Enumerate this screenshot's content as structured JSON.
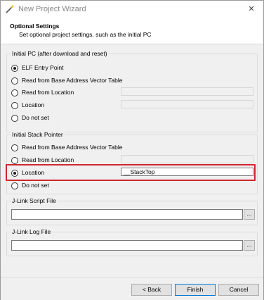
{
  "window": {
    "title": "New Project Wizard",
    "close_glyph": "✕",
    "icon": "wand-icon"
  },
  "header": {
    "title": "Optional Settings",
    "subtitle": "Set optional project settings, such as the initial PC"
  },
  "initial_pc": {
    "label": "Initial PC (after download and reset)",
    "options": [
      {
        "label": "ELF Entry Point",
        "checked": true
      },
      {
        "label": "Read from Base Address Vector Table",
        "checked": false
      },
      {
        "label": "Read from Location",
        "checked": false
      },
      {
        "label": "Location",
        "checked": false
      },
      {
        "label": "Do not set",
        "checked": false
      }
    ]
  },
  "initial_sp": {
    "label": "Initial Stack Pointer",
    "options": [
      {
        "label": "Read from Base Address Vector Table",
        "checked": false
      },
      {
        "label": "Read from Location",
        "checked": false
      },
      {
        "label": "Location",
        "checked": true
      },
      {
        "label": "Do not set",
        "checked": false
      }
    ],
    "location_value": "__StackTop"
  },
  "jlink_script": {
    "label": "J-Link Script File",
    "value": "",
    "browse_label": "..."
  },
  "jlink_log": {
    "label": "J-Link Log File",
    "value": "",
    "browse_label": "..."
  },
  "footer": {
    "back_label": "< Back",
    "finish_label": "Finish",
    "cancel_label": "Cancel"
  },
  "colors": {
    "highlight": "#d0272d",
    "default_button_border": "#0078d7"
  }
}
